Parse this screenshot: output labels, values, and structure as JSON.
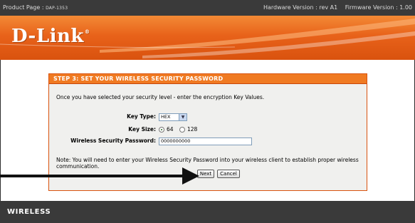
{
  "topbar": {
    "product_label": "Product Page : ",
    "product_model": "DAP-1353",
    "hardware": "Hardware Version : rev A1",
    "firmware": "Firmware Version : 1.00"
  },
  "header": {
    "logo": "D-Link"
  },
  "wizard": {
    "title": "STEP 3: SET YOUR WIRELESS SECURITY PASSWORD",
    "intro": "Once you have selected your security level - enter the encryption Key Values.",
    "key_type_label": "Key Type:",
    "key_type_value": "HEX",
    "key_size_label": "Key Size:",
    "key_size_options": [
      "64",
      "128"
    ],
    "key_size_selected": "64",
    "password_label": "Wireless Security Password:",
    "password_value": "0000000000",
    "note": "Note: You will need to enter your Wireless Security Password into your wireless client to establish proper wireless communication.",
    "next_label": "Next",
    "cancel_label": "Cancel"
  },
  "footer": {
    "label": "WIRELESS"
  },
  "colors": {
    "brand_orange": "#f07a22",
    "dark_bar": "#3a3a3a"
  }
}
